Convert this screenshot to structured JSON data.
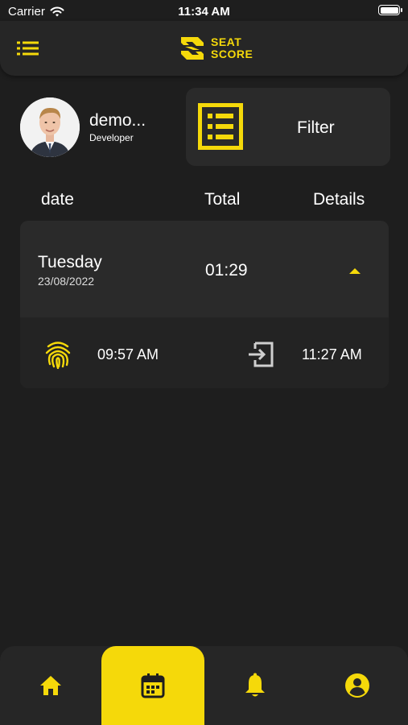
{
  "status_bar": {
    "carrier": "Carrier",
    "time": "11:34 AM",
    "battery_level": 1.0
  },
  "header": {
    "logo_line1": "SEAT",
    "logo_line2": "SCORE",
    "menu_icon": "list-icon"
  },
  "profile": {
    "name": "demo...",
    "role": "Developer"
  },
  "filter": {
    "label": "Filter",
    "icon": "list-alt-icon"
  },
  "columns": {
    "date": "date",
    "total": "Total",
    "details": "Details"
  },
  "days": [
    {
      "day": "Tuesday",
      "date": "23/08/2022",
      "total": "01:29",
      "entries": [
        {
          "in_time": "09:57 AM",
          "out_time": "11:27 AM"
        }
      ]
    }
  ],
  "bottom_nav": {
    "items": [
      "home-icon",
      "calendar-icon",
      "bell-icon",
      "account-circle-icon"
    ],
    "active": "calendar-icon"
  },
  "colors": {
    "accent": "#f5d90a",
    "background": "#1e1e1e",
    "card": "#2a2a2a",
    "icon_gray": "#cfcfcf"
  }
}
